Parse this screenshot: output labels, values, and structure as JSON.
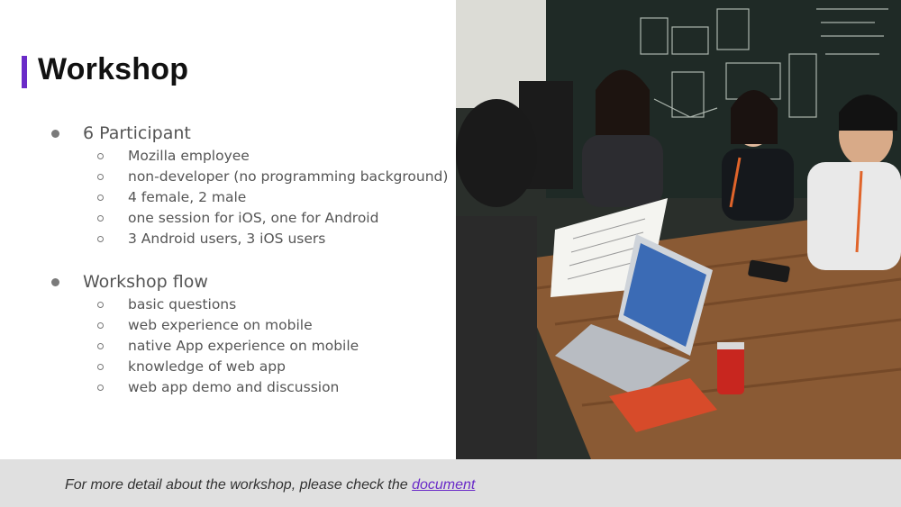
{
  "slide": {
    "title": "Workshop",
    "sections": [
      {
        "label": "6 Participant",
        "items": [
          "Mozilla employee",
          "non-developer (no programming background)",
          "4 female, 2 male",
          "one session for iOS, one for Android",
          "3 Android users, 3 iOS users"
        ]
      },
      {
        "label": "Workshop flow",
        "items": [
          "basic questions",
          "web experience on mobile",
          "native App experience on mobile",
          "knowledge of web app",
          "web app demo and discussion"
        ]
      }
    ]
  },
  "footer": {
    "text": "For more detail about the workshop, please check the ",
    "link_label": "document"
  },
  "colors": {
    "accent": "#6a2bc8",
    "footer_bg": "#e0e0e0",
    "body_text": "#555555"
  }
}
